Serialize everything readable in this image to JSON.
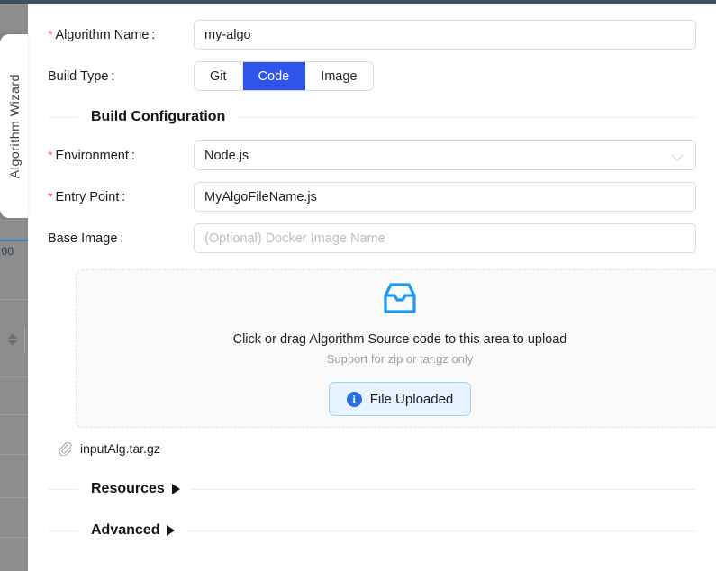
{
  "backdrop": {
    "partial_time_text": ":00",
    "sorter_icon": "sort-arrows-icon"
  },
  "handle_tab": {
    "label": "Algorithm Wizard",
    "name": "algorithm-wizard-tab"
  },
  "form": {
    "algorithm_name": {
      "label": "Algorithm Name :",
      "required": true,
      "value": "my-algo",
      "placeholder": ""
    },
    "build_type": {
      "label": "Build Type :",
      "options": [
        "Git",
        "Code",
        "Image"
      ],
      "selected": "Code"
    }
  },
  "build_configuration": {
    "title": "Build Configuration",
    "environment": {
      "label": "Environment :",
      "required": true,
      "value": "Node.js",
      "icon": "chevron-down-icon"
    },
    "entry_point": {
      "label": "Entry Point :",
      "required": true,
      "value": "MyAlgoFileName.js"
    },
    "base_image": {
      "label": "Base Image :",
      "required": false,
      "value": "",
      "placeholder": "(Optional) Docker Image Name"
    }
  },
  "upload": {
    "icon": "inbox-icon",
    "primary_text": "Click or drag Algorithm Source code to this area to upload",
    "secondary_text": "Support for zip or tar.gz only",
    "button": {
      "label": "File Uploaded",
      "icon": "info-circle-icon",
      "icon_glyph": "i"
    },
    "uploaded_file": {
      "name": "inputAlg.tar.gz",
      "icon": "paperclip-icon"
    }
  },
  "collapsed_sections": [
    {
      "title": "Resources",
      "icon": "caret-right-icon",
      "expanded": false
    },
    {
      "title": "Advanced",
      "icon": "caret-right-icon",
      "expanded": false
    }
  ],
  "colors": {
    "accent_blue": "#2f54eb",
    "upload_icon_blue": "#1a9bf0",
    "required_red": "#f5476b",
    "info_badge_blue": "#2f6fe0",
    "upload_btn_bg": "#e7f4ff",
    "top_bar": "#3c4f5c",
    "backdrop": "#8a8a8a"
  }
}
